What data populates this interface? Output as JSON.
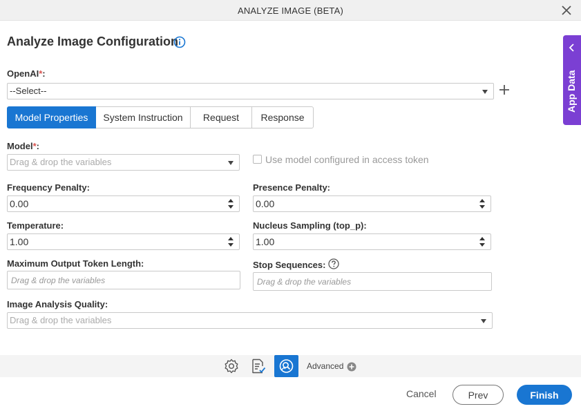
{
  "window": {
    "title": "ANALYZE IMAGE (BETA)",
    "close_icon": "close-icon"
  },
  "heading": "Analyze Image Configuration",
  "openai": {
    "label": "OpenAI",
    "required": "*",
    "colon": ":",
    "selected": "--Select--"
  },
  "tabs": [
    {
      "label": "Model Properties",
      "active": true
    },
    {
      "label": "System Instruction",
      "active": false
    },
    {
      "label": "Request",
      "active": false
    },
    {
      "label": "Response",
      "active": false
    }
  ],
  "model": {
    "label": "Model",
    "required": "*",
    "colon": ":",
    "placeholder": "Drag & drop the variables",
    "checkbox_label": "Use model configured in access token",
    "checkbox_checked": false
  },
  "frequency_penalty": {
    "label": "Frequency Penalty:",
    "value": "0.00"
  },
  "presence_penalty": {
    "label": "Presence Penalty:",
    "value": "0.00"
  },
  "temperature": {
    "label": "Temperature:",
    "value": "1.00"
  },
  "nucleus_sampling": {
    "label": "Nucleus Sampling (top_p):",
    "value": "1.00"
  },
  "max_output_tokens": {
    "label": "Maximum Output Token Length:",
    "placeholder": "Drag & drop the variables"
  },
  "stop_sequences": {
    "label": "Stop Sequences:",
    "placeholder": "Drag & drop the variables"
  },
  "image_quality": {
    "label": "Image Analysis Quality:",
    "placeholder": "Drag & drop the variables"
  },
  "app_data": {
    "label": "App Data"
  },
  "toolbar": {
    "icons": [
      "gear-icon",
      "document-check-icon",
      "image-search-icon"
    ],
    "advanced_label": "Advanced"
  },
  "footer": {
    "cancel": "Cancel",
    "prev": "Prev",
    "finish": "Finish"
  },
  "colors": {
    "primary": "#1976d2",
    "app_data": "#7b3fd3",
    "required": "#d9534f"
  }
}
